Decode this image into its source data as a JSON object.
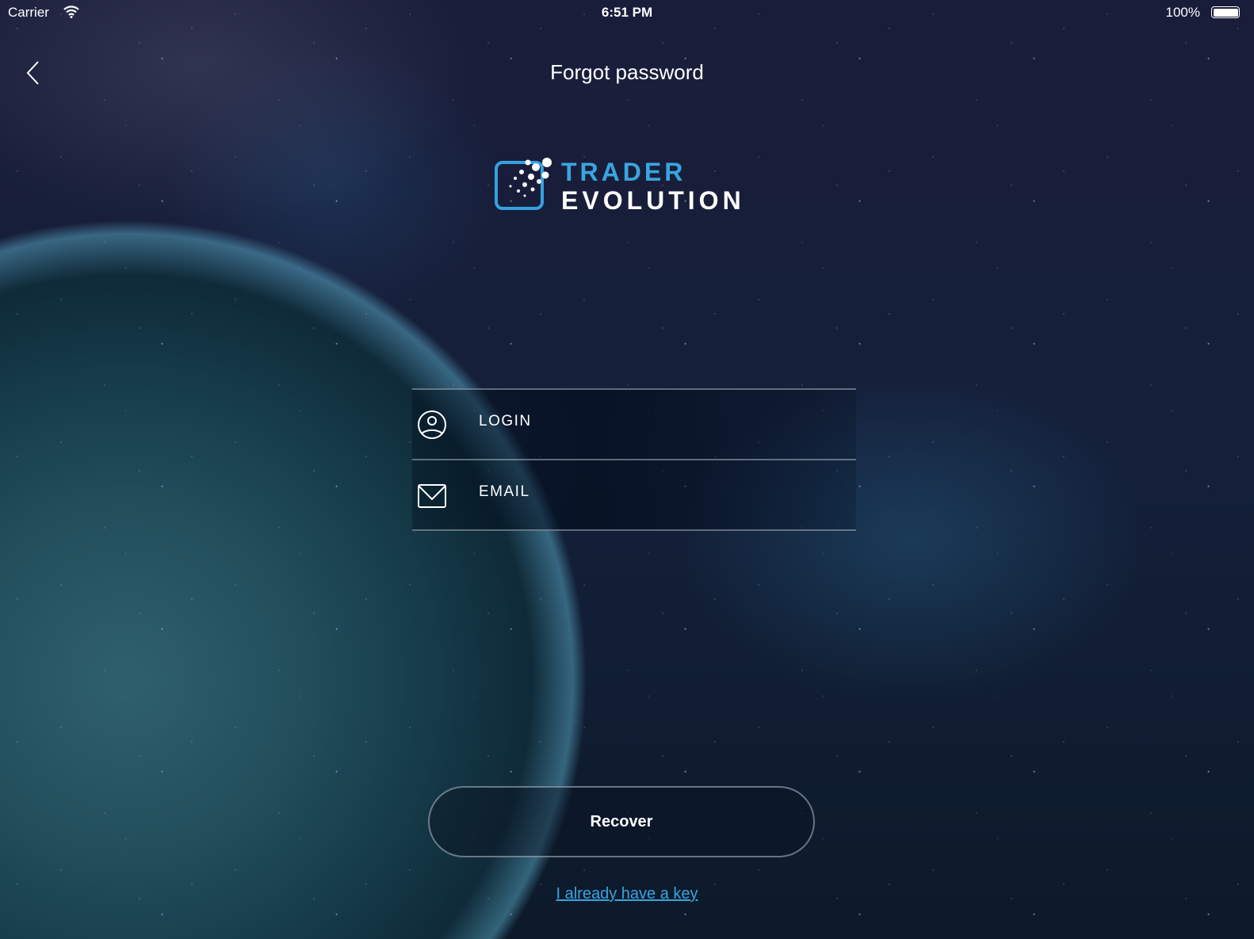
{
  "status_bar": {
    "carrier": "Carrier",
    "time": "6:51 PM",
    "battery": "100%"
  },
  "nav": {
    "title": "Forgot password"
  },
  "logo": {
    "line1": "TRADER",
    "line2": "EVOLUTION"
  },
  "form": {
    "login_placeholder": "LOGIN",
    "email_placeholder": "EMAIL"
  },
  "actions": {
    "recover": "Recover",
    "have_key": "I already have a key"
  },
  "colors": {
    "accent": "#3aa4e0"
  }
}
